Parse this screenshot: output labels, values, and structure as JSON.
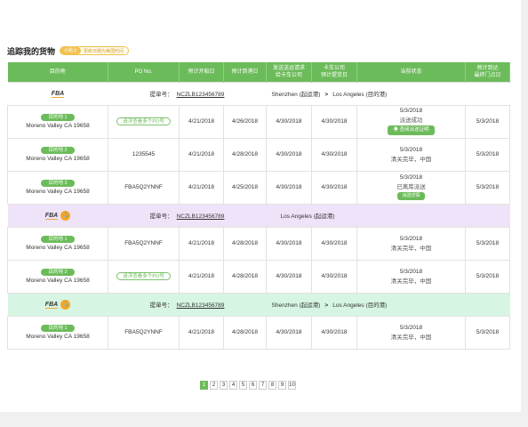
{
  "header": {
    "title": "追踪我的货物",
    "tag_pill": "小贴士",
    "tag_text": "更新日期为美国时间"
  },
  "table": {
    "columns": [
      "目的地",
      "PO No.",
      "预计开船日",
      "预计到港日",
      "发送送运请求\n给卡车公司",
      "卡车公司\n预计提货日",
      "当前状态",
      "预计到达\n最终门点日"
    ],
    "tracking_label": "提单号：",
    "shipments": [
      {
        "tracking_no": "NCZLB123456789",
        "route_from": "Shenzhen (起运港)",
        "route_arrow": ">",
        "route_to": "Los Angeles (目的港)",
        "rows": [
          {
            "dest": "目的地 1",
            "addr": "Moreno Valley CA 19658",
            "po": "",
            "po_btn": "请浮查看多个PO号",
            "etd": "4/21/2018",
            "eta": "4/26/2018",
            "req": "4/30/2018",
            "pickup": "4/30/2018",
            "status_date": "5/3/2018",
            "status_text": "派送成功",
            "status_btn": "查阅派送证明",
            "final": "5/3/2018"
          },
          {
            "dest": "目的地 2",
            "addr": "Moreno Valley CA 19658",
            "po": "1235545",
            "po_btn": "",
            "etd": "4/21/2018",
            "eta": "4/28/2018",
            "req": "4/30/2018",
            "pickup": "4/30/2018",
            "status_date": "5/3/2018",
            "status_text": "清关完毕，中国",
            "status_btn": "",
            "final": "5/3/2018"
          },
          {
            "dest": "目的地 3",
            "addr": "Moreno Valley CA 19658",
            "po": "FBA5Q2YNNF",
            "po_btn": "",
            "etd": "4/21/2018",
            "eta": "4/25/2018",
            "req": "4/30/2018",
            "pickup": "4/30/2018",
            "status_date": "5/3/2018",
            "status_text": "已离库派送",
            "status_btn": "派送详情",
            "final": "5/3/2018"
          }
        ]
      },
      {
        "tracking_no": "NCZLB123456789",
        "route_from": "",
        "route_arrow": "",
        "route_to": "Los Angeles (起运港)",
        "rows": [
          {
            "dest": "目的地 1",
            "addr": "Moreno Valley CA 19658",
            "po": "FBA5Q2YNNF",
            "po_btn": "",
            "etd": "4/21/2018",
            "eta": "4/28/2018",
            "req": "4/30/2018",
            "pickup": "4/30/2018",
            "status_date": "5/3/2018",
            "status_text": "清关完毕，中国",
            "status_btn": "",
            "final": "5/3/2018"
          },
          {
            "dest": "目的地 2",
            "addr": "Moreno Valley CA 19658",
            "po": "",
            "po_btn": "请浮查看多个PO号",
            "etd": "4/21/2018",
            "eta": "4/28/2018",
            "req": "4/30/2018",
            "pickup": "4/30/2018",
            "status_date": "5/3/2018",
            "status_text": "清关完毕，中国",
            "status_btn": "",
            "final": "5/3/2018"
          }
        ]
      },
      {
        "tracking_no": "NCZLB123456789",
        "route_from": "Shenzhen (起运港)",
        "route_arrow": ">",
        "route_to": "Los Angeles (目的港)",
        "rows": [
          {
            "dest": "目的地 1",
            "addr": "Moreno Valley CA 19658",
            "po": "FBA5Q2YNNF",
            "po_btn": "",
            "etd": "4/21/2018",
            "eta": "4/28/2018",
            "req": "4/30/2018",
            "pickup": "4/30/2018",
            "status_date": "5/3/2018",
            "status_text": "清关完毕，中国",
            "status_btn": "",
            "final": "5/3/2018"
          }
        ]
      }
    ]
  },
  "logo": {
    "text": "FBA"
  },
  "pagination": [
    "1",
    "2",
    "3",
    "4",
    "5",
    "6",
    "7",
    "8",
    "9",
    "10"
  ],
  "colors": {
    "accent": "#6cbb5a",
    "tag": "#f2c14e",
    "ship2_bg": "#efe3f9",
    "ship3_bg": "#d7f5e3"
  }
}
